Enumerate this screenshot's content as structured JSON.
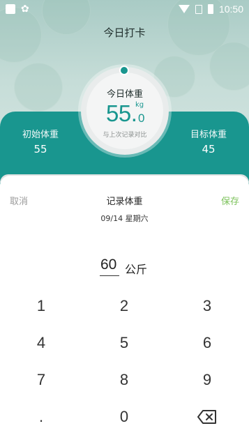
{
  "status_bar": {
    "time": "10:50"
  },
  "header": {
    "title": "今日打卡"
  },
  "stats": {
    "initial_label": "初始体重",
    "initial_value": "55",
    "target_label": "目标体重",
    "target_value": "45"
  },
  "today": {
    "label": "今日体重",
    "value_int": "55.",
    "value_decimal": "0",
    "unit": "kg",
    "compare": "与上次记录对比"
  },
  "sheet": {
    "cancel": "取消",
    "title": "记录体重",
    "save": "保存",
    "date": "09/14 星期六",
    "input_value": "60",
    "input_unit": "公斤"
  },
  "keypad": [
    "1",
    "2",
    "3",
    "4",
    "5",
    "6",
    "7",
    "8",
    "9",
    ".",
    "0"
  ],
  "colors": {
    "accent": "#19968f",
    "save": "#7cc25b"
  }
}
